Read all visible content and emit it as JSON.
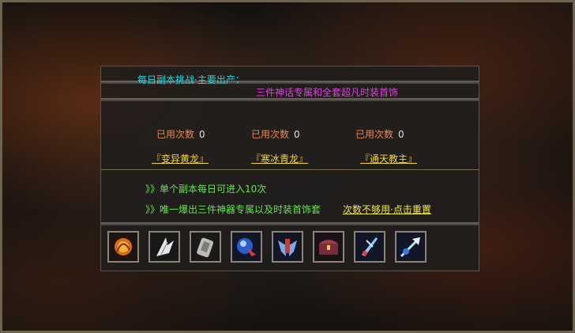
{
  "header": {
    "title": "每日副本挑战·主要出产：",
    "subtitle": "三件神话专属和全套超凡时装首饰"
  },
  "dungeons": [
    {
      "used_label": "已用次数",
      "used_count": "0",
      "name": "『变异黄龙』"
    },
    {
      "used_label": "已用次数",
      "used_count": "0",
      "name": "『寒冰青龙』"
    },
    {
      "used_label": "已用次数",
      "used_count": "0",
      "name": "『通天教主』"
    }
  ],
  "rules": {
    "line1": "》》单个副本每日可进入10次",
    "line2": "》》唯一爆出三件神器专属以及时装首饰套",
    "reset_link": "次数不够用·点击重置"
  },
  "rewards": [
    {
      "icon": "fire-orb-icon"
    },
    {
      "icon": "white-wing-icon"
    },
    {
      "icon": "silver-scroll-icon"
    },
    {
      "icon": "blue-crystal-icon"
    },
    {
      "icon": "winged-armor-icon"
    },
    {
      "icon": "treasure-chest-icon"
    },
    {
      "icon": "blue-blade-icon"
    },
    {
      "icon": "crystal-spear-icon"
    }
  ]
}
